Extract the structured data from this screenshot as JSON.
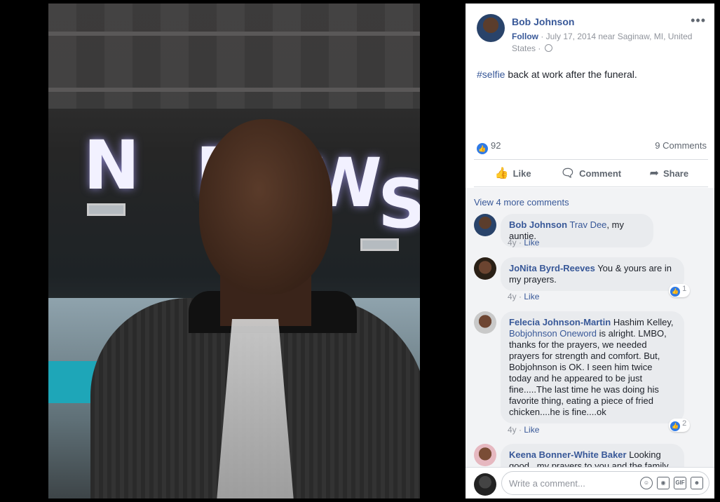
{
  "photo": {
    "alt_letters": [
      "N",
      "E",
      "W",
      "S"
    ]
  },
  "post": {
    "author": "Bob Johnson",
    "follow": "Follow",
    "meta": " · July 17, 2014 near Saginaw, MI, United States · ",
    "more": "•••",
    "hashtag": "#selfie",
    "text": " back at work after the funeral."
  },
  "stats": {
    "reactions": "92",
    "comments": "9 Comments"
  },
  "actions": [
    {
      "label": "Like",
      "icon": "thumbs-up-icon"
    },
    {
      "label": "Comment",
      "icon": "speech-bubble-icon"
    },
    {
      "label": "Share",
      "icon": "share-arrow-icon"
    }
  ],
  "comments": {
    "view_more": "View 4 more comments",
    "items": [
      {
        "name": "Bob Johnson",
        "tag": "Trav Dee",
        "text": ", my auntie.",
        "time": "4y",
        "like": "Like",
        "reactions": ""
      },
      {
        "name": "JoNita Byrd-Reeves",
        "tag": "",
        "text": " You & yours are in my prayers.",
        "time": "4y",
        "like": "Like",
        "reactions": "1"
      },
      {
        "name": "Felecia Johnson-Martin",
        "tag": "Bobjohnson Oneword",
        "text_pre": " Hashim Kelley, ",
        "text": " is alright. LMBO, thanks for the prayers, we needed prayers for strength and comfort. But, Bobjohnson is OK. I seen him twice today and he appeared to be just fine.....The last time he was doing his favorite thing, eating a piece of fried chicken....he is fine....ok",
        "time": "4y",
        "like": "Like",
        "reactions": "2"
      },
      {
        "name": "Keena Bonner-White Baker",
        "tag": "",
        "text": " Looking good...my prayers to you and the family",
        "time": "",
        "like": "",
        "reactions": ""
      }
    ]
  },
  "composer": {
    "placeholder": "Write a comment...",
    "icons": [
      "emoji-icon",
      "camera-icon",
      "gif-icon",
      "sticker-icon"
    ]
  },
  "colors": {
    "link": "#385898",
    "like_blue": "#2f7ae5",
    "comment_bg": "#e9ebee"
  }
}
